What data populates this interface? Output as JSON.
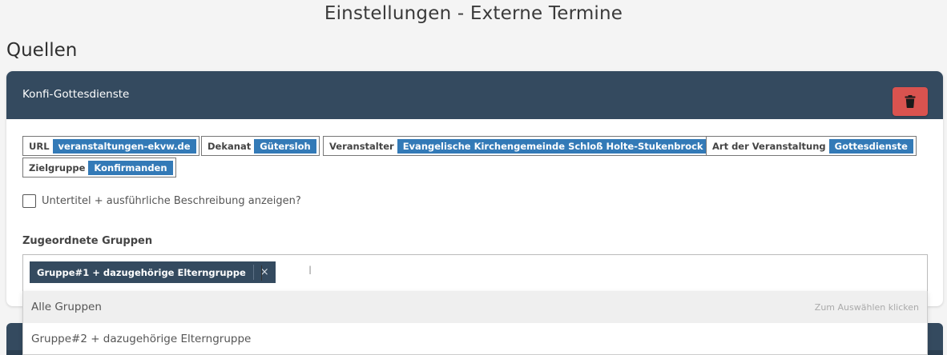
{
  "page": {
    "title": "Einstellungen - Externe Termine",
    "section_title": "Quellen"
  },
  "card": {
    "title": "Konfi-Gottesdienste",
    "delete_icon": "trash-icon",
    "tags": [
      {
        "key": "URL",
        "value": "veranstaltungen-ekvw.de"
      },
      {
        "key": "Dekanat",
        "value": "Gütersloh"
      },
      {
        "key": "Veranstalter",
        "value": "Evangelische Kirchengemeinde Schloß Holte-Stukenbrock"
      },
      {
        "key": "Art der Veranstaltung",
        "value": "Gottesdienste"
      },
      {
        "key": "Zielgruppe",
        "value": "Konfirmanden"
      }
    ],
    "checkbox": {
      "label": "Untertitel + ausführliche Beschreibung anzeigen?",
      "checked": false
    },
    "groups": {
      "label": "Zugeordnete Gruppen",
      "selected": [
        {
          "label": "Gruppe#1 + dazugehörige Elterngruppe",
          "remove": "×"
        }
      ],
      "dropdown": [
        {
          "label": "Alle Gruppen",
          "hint": "Zum Auswählen klicken"
        },
        {
          "label": "Gruppe#2 + dazugehörige Elterngruppe",
          "hint": ""
        }
      ]
    }
  },
  "colors": {
    "header": "#344a5f",
    "tag_value": "#337ab7",
    "danger": "#d9534f"
  }
}
